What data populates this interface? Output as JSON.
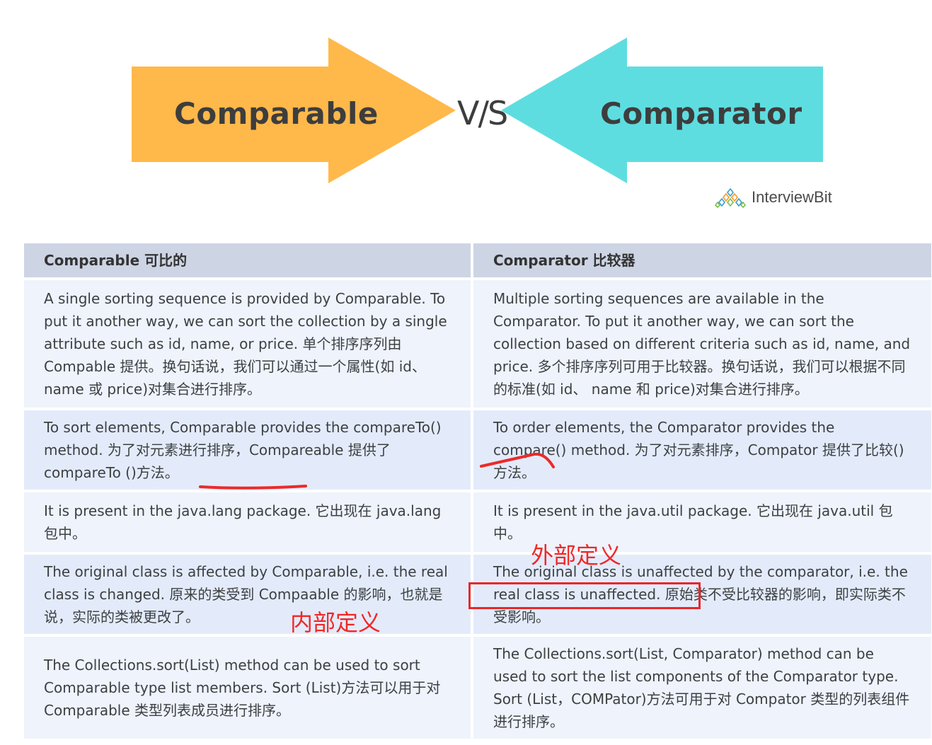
{
  "banner": {
    "left_label": "Comparable",
    "vs": "V/S",
    "right_label": "Comparator",
    "brand": "InterviewBit",
    "colors": {
      "left_arrow": "#ffb84a",
      "right_arrow": "#5edde0"
    }
  },
  "table": {
    "headers": [
      "Comparable   可比的",
      "Comparator   比较器"
    ],
    "rows": [
      {
        "comparable": "A single sorting sequence is provided by Comparable. To put it another way, we can sort the collection by a single attribute such as id, name, or price. 单个排序序列由 Compable 提供。换句话说，我们可以通过一个属性(如 id、 name 或 price)对集合进行排序。",
        "comparator": "Multiple sorting sequences are available in the Comparator. To put it another way, we can sort the collection based on different criteria such as id, name, and price. 多个排序序列可用于比较器。换句话说，我们可以根据不同的标准(如 id、 name 和 price)对集合进行排序。"
      },
      {
        "comparable": "To sort elements, Comparable provides the compareTo() method. 为了对元素进行排序，Compareable 提供了 compareTo ()方法。",
        "comparator": "To order elements, the Comparator provides the compare() method. 为了对元素排序，Compator 提供了比较()方法。"
      },
      {
        "comparable": "It is present in the java.lang package. 它出现在 java.lang 包中。",
        "comparator": "It is present in the java.util package. 它出现在 java.util 包中。"
      },
      {
        "comparable": "The original class is affected by Comparable, i.e. the real class is changed. 原来的类受到 Compaable 的影响，也就是说，实际的类被更改了。",
        "comparator": "The original class is unaffected by the comparator, i.e. the real class is unaffected. 原始类不受比较器的影响，即实际类不受影响。"
      },
      {
        "comparable": "The Collections.sort(List) method can be used to sort Comparable type list members. Sort (List)方法可以用于对 Comparable 类型列表成员进行排序。",
        "comparator": "The Collections.sort(List, Comparator) method can be used to sort the list components of the Comparator type. Sort (List，COMPator)方法可用于对 Compator 类型的列表组件进行排序。"
      }
    ]
  },
  "annotations": {
    "internal": "内部定义",
    "external": "外部定义",
    "color": "#f02828"
  }
}
